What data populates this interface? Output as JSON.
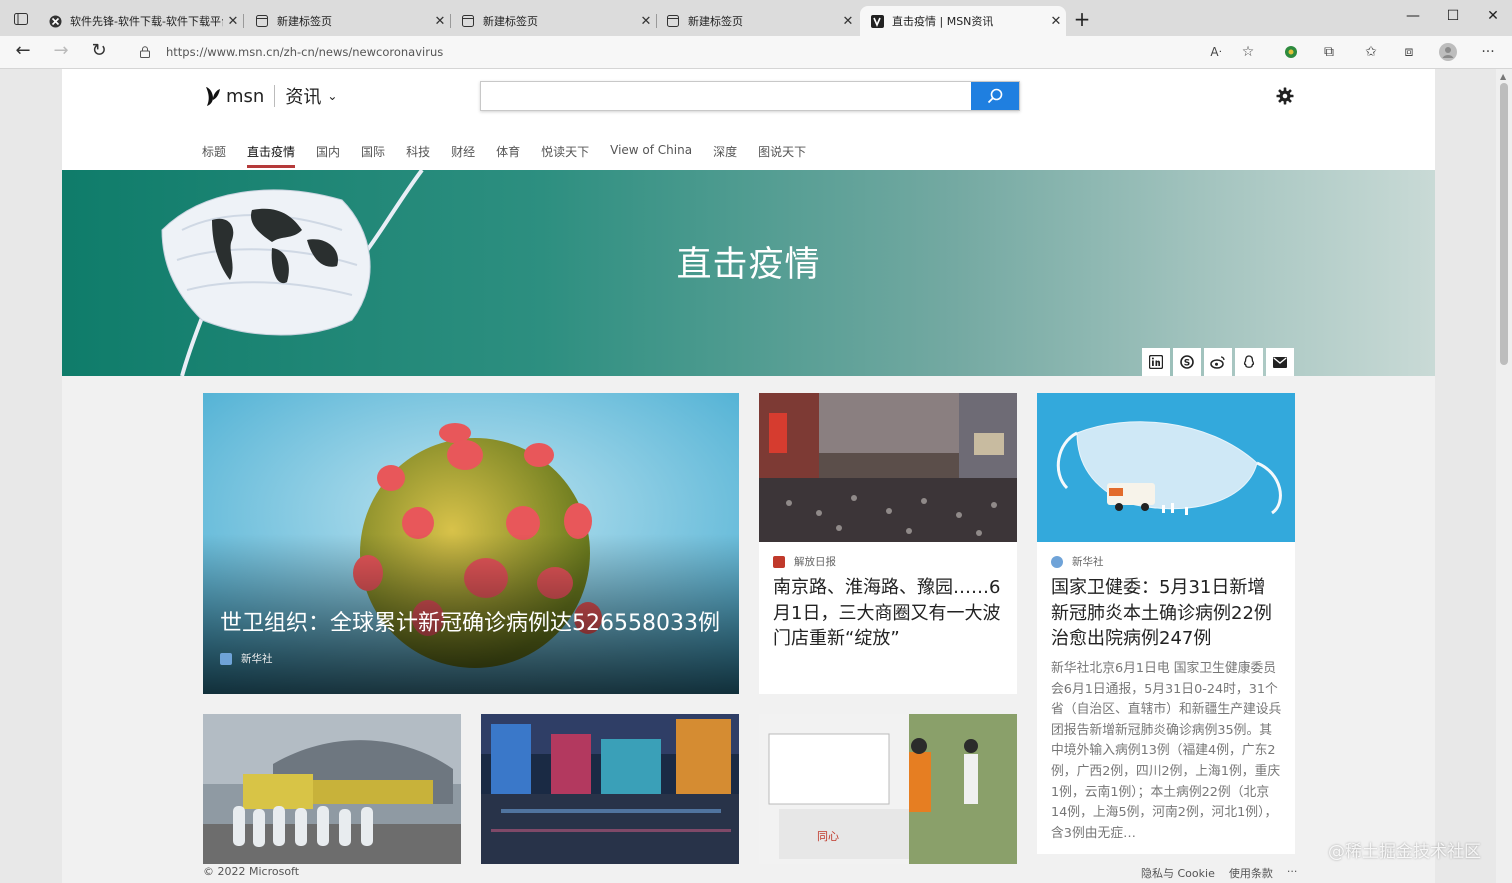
{
  "browser": {
    "tabs": [
      {
        "title": "软件先锋-软件下载-软件下载平台",
        "favicon": "globe-icon",
        "active": false
      },
      {
        "title": "新建标签页",
        "favicon": "newtab-page-icon",
        "active": false
      },
      {
        "title": "新建标签页",
        "favicon": "newtab-page-icon",
        "active": false
      },
      {
        "title": "新建标签页",
        "favicon": "newtab-page-icon",
        "active": false
      },
      {
        "title": "直击疫情 | MSN资讯",
        "favicon": "msn-icon",
        "active": true
      }
    ],
    "url": "https://www.msn.cn/zh-cn/news/newcoronavirus"
  },
  "header": {
    "logo_text": "msn",
    "section": "资讯",
    "search_placeholder": "",
    "nav": [
      {
        "label": "标题",
        "active": false
      },
      {
        "label": "直击疫情",
        "active": true
      },
      {
        "label": "国内",
        "active": false
      },
      {
        "label": "国际",
        "active": false
      },
      {
        "label": "科技",
        "active": false
      },
      {
        "label": "财经",
        "active": false
      },
      {
        "label": "体育",
        "active": false
      },
      {
        "label": "悦读天下",
        "active": false
      },
      {
        "label": "View of China",
        "active": false
      },
      {
        "label": "深度",
        "active": false
      },
      {
        "label": "图说天下",
        "active": false
      }
    ]
  },
  "hero": {
    "title": "直击疫情",
    "share_icons": [
      "linkedin-icon",
      "skype-icon",
      "weibo-icon",
      "qq-icon",
      "mail-icon"
    ]
  },
  "cards": {
    "big": {
      "headline": "世卫组织：全球累计新冠确诊病例达526558033例",
      "source": "新华社"
    },
    "mid": {
      "source": "解放日报",
      "headline": "南京路、淮海路、豫园……6月1日，三大商圈又有一大波门店重新“绽放”"
    },
    "right": {
      "source": "新华社",
      "headline": "国家卫健委：5月31日新增新冠肺炎本土确诊病例22例 治愈出院病例247例",
      "summary": "新华社北京6月1日电 国家卫生健康委员会6月1日通报，5月31日0-24时，31个省（自治区、直辖市）和新疆生产建设兵团报告新增新冠肺炎确诊病例35例。其中境外输入病例13例（福建4例，广东2例，广西2例，四川2例，上海1例，重庆1例，云南1例）；本土病例22例（北京14例，上海5例，河南2例，河北1例），含3例由无症…"
    }
  },
  "footer": {
    "copyright": "© 2022 Microsoft",
    "privacy": "隐私与 Cookie",
    "terms": "使用条款",
    "more": "···"
  },
  "watermark": "@稀土掘金技术社区",
  "colors": {
    "accent": "#1f7fe0",
    "nav_active_underline": "#b53a3a",
    "hero_green": "#0f7c6a"
  }
}
